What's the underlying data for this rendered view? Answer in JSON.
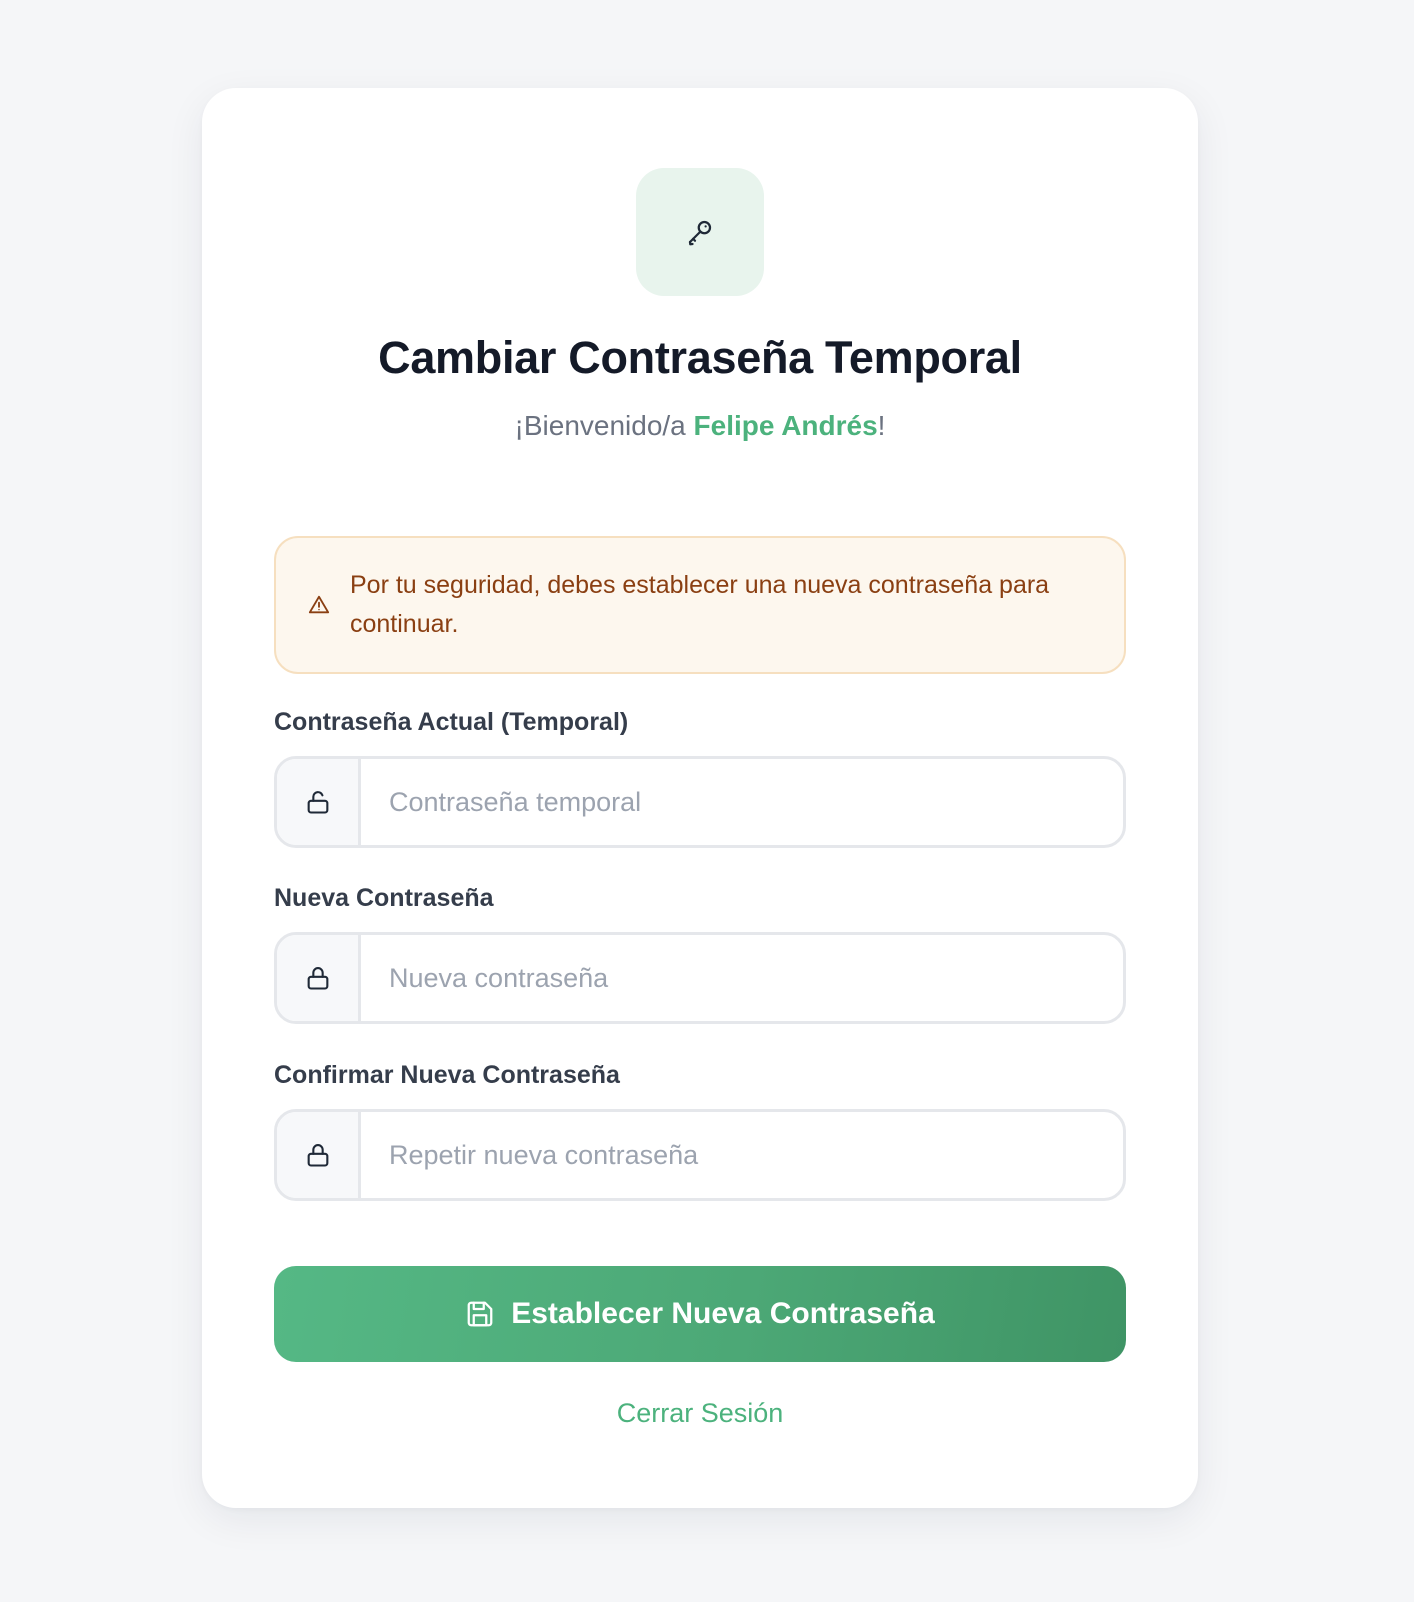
{
  "header": {
    "icon": "key-icon",
    "title": "Cambiar Contraseña Temporal",
    "welcome_prefix": "¡Bienvenido/a ",
    "user_name": "Felipe Andrés",
    "welcome_suffix": "!"
  },
  "alert": {
    "icon": "warning-triangle-icon",
    "message": "Por tu seguridad, debes establecer una nueva contraseña para continuar."
  },
  "form": {
    "current_password": {
      "label": "Contraseña Actual (Temporal)",
      "placeholder": "Contraseña temporal",
      "value": "",
      "icon": "lock-open-icon"
    },
    "new_password": {
      "label": "Nueva Contraseña",
      "placeholder": "Nueva contraseña",
      "value": "",
      "icon": "lock-icon"
    },
    "confirm_password": {
      "label": "Confirmar Nueva Contraseña",
      "placeholder": "Repetir nueva contraseña",
      "value": "",
      "icon": "lock-icon"
    },
    "submit": {
      "label": "Establecer Nueva Contraseña",
      "icon": "save-icon"
    }
  },
  "footer": {
    "logout_label": "Cerrar Sesión"
  },
  "colors": {
    "accent": "#4cb27d",
    "page_background": "#f5f6f8",
    "alert_background": "#fdf7ee",
    "alert_text": "#8a3f12",
    "title": "#141a28"
  }
}
